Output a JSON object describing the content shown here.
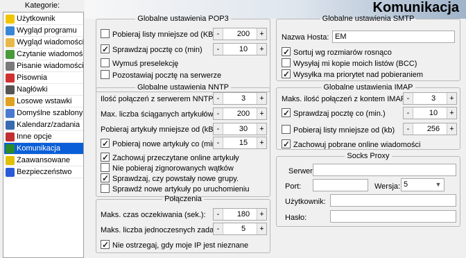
{
  "sidebar": {
    "title": "Kategorie:",
    "items": [
      {
        "label": "Użytkownik",
        "icon": "smiley-icon",
        "color": "#f2c500"
      },
      {
        "label": "Wygląd programu",
        "icon": "palette-icon",
        "color": "#3a86d6"
      },
      {
        "label": "Wygląd wiadomości",
        "icon": "envelope-icon",
        "color": "#e8b84a"
      },
      {
        "label": "Czytanie wiadomości",
        "icon": "read-mail-icon",
        "color": "#4a9a3a"
      },
      {
        "label": "Pisanie wiadomości",
        "icon": "write-mail-icon",
        "color": "#7a7a7a"
      },
      {
        "label": "Pisownia",
        "icon": "spelling-icon",
        "color": "#d03030"
      },
      {
        "label": "Nagłówki",
        "icon": "header-icon",
        "color": "#555555"
      },
      {
        "label": "Losowe wstawki",
        "icon": "notes-icon",
        "color": "#e0a020"
      },
      {
        "label": "Domyślne szablony",
        "icon": "template-icon",
        "color": "#4a7ad0"
      },
      {
        "label": "Kalendarz/zadania",
        "icon": "calendar-icon",
        "color": "#3a6ab0"
      },
      {
        "label": "Inne opcje",
        "icon": "tools-icon",
        "color": "#c03030"
      },
      {
        "label": "Komunikacja",
        "icon": "network-icon",
        "color": "#2a8a2a"
      },
      {
        "label": "Zaawansowane",
        "icon": "lightning-icon",
        "color": "#e0c000"
      },
      {
        "label": "Bezpieczeństwo",
        "icon": "shield-icon",
        "color": "#2a5ad8"
      }
    ],
    "selected_index": 11
  },
  "header": {
    "title": "Komunikacja"
  },
  "pop3": {
    "title": "Globalne ustawienia POP3",
    "fetch_smaller": {
      "label": "Pobieraj listy mniejsze od (KB)",
      "checked": false,
      "value": "200"
    },
    "check_mail": {
      "label": "Sprawdzaj pocztę co (min)",
      "checked": true,
      "value": "10"
    },
    "force_preselect": {
      "label": "Wymuś preselekcję",
      "checked": false
    },
    "leave_on_server": {
      "label": "Pozostawiaj pocztę na serwerze",
      "checked": false
    }
  },
  "nntp": {
    "title": "Globalne ustawienia NNTP",
    "connections": {
      "label": "Ilość połączeń z serwerem NNTP:",
      "value": "3"
    },
    "max_articles": {
      "label": "Max. liczba ściąganych artykułów:",
      "value": "200"
    },
    "fetch_smaller": {
      "label": "Pobieraj artykuły mniejsze od (kB):",
      "value": "30"
    },
    "fetch_new": {
      "label": "Pobieraj nowe artykuły co (min.)",
      "checked": true,
      "value": "15"
    },
    "save_read": {
      "label": "Zachowuj przeczytane online artykuły",
      "checked": true
    },
    "skip_ignored": {
      "label": "Nie pobieraj zignorowanych wątków",
      "checked": false
    },
    "check_new_groups": {
      "label": "Sprawdzaj, czy powstały nowe grupy.",
      "checked": true
    },
    "check_new_on_start": {
      "label": "Sprawdź nowe artykuły po uruchomieniu",
      "checked": false
    }
  },
  "connections": {
    "title": "Połączenia",
    "timeout": {
      "label": "Maks. czas oczekiwania (sek.):",
      "value": "180"
    },
    "simultaneous": {
      "label": "Maks. liczba jednoczesnych zadań:",
      "value": "5"
    },
    "no_warn_ip": {
      "label": "Nie ostrzegaj, gdy moje IP jest nieznane",
      "checked": true
    }
  },
  "smtp": {
    "title": "Globalne ustawienia SMTP",
    "host_label": "Nazwa Hosta:",
    "host_value": "EM",
    "sort_by_size": {
      "label": "Sortuj wg rozmiarów rosnąco",
      "checked": true
    },
    "send_copy_bcc": {
      "label": "Wysyłaj mi kopie moich listów (BCC)",
      "checked": false
    },
    "send_priority": {
      "label": "Wysyłka ma priorytet nad pobieraniem",
      "checked": true
    }
  },
  "imap": {
    "title": "Globalne ustawienia IMAP",
    "connections": {
      "label": "Maks. ilość połączeń z kontem IMAP:",
      "value": "3"
    },
    "check_mail": {
      "label": "Sprawdzaj pocztę co (min.)",
      "checked": true,
      "value": "10"
    },
    "fetch_smaller": {
      "label": "Pobieraj listy mniejsze od (kb)",
      "checked": false,
      "value": "256"
    },
    "save_fetched": {
      "label": "Zachowuj pobrane online wiadomości",
      "checked": true
    }
  },
  "socks": {
    "title": "Socks Proxy",
    "server_label": "Serwer:",
    "server_value": "",
    "port_label": "Port:",
    "port_value": "",
    "version_label": "Wersja:",
    "version_value": "5",
    "user_label": "Użytkownik:",
    "user_value": "",
    "pass_label": "Hasło:",
    "pass_value": ""
  },
  "spin": {
    "minus": "-",
    "plus": "+"
  }
}
